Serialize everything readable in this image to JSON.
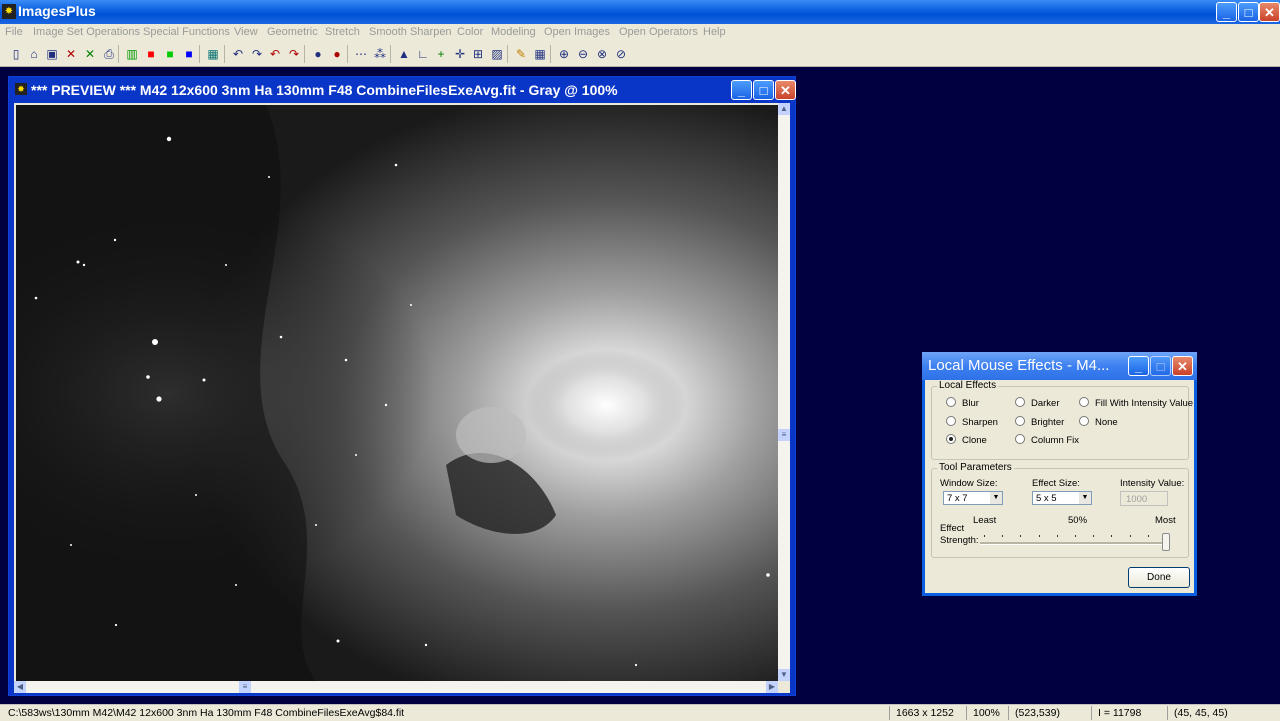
{
  "app": {
    "title": "ImagesPlus",
    "icon_glyph": "✸",
    "controls": {
      "minimize": "_",
      "maximize": "□",
      "close": "✕"
    }
  },
  "menu": [
    "File",
    "Image Set Operations",
    "Special Functions",
    "View",
    "Geometric",
    "Stretch",
    "Smooth Sharpen",
    "Color",
    "Modeling",
    "Open Images",
    "Open Operators",
    "Help"
  ],
  "toolbar_icons": [
    {
      "name": "new-file-icon",
      "glyph": "▯"
    },
    {
      "name": "open-folder-icon",
      "glyph": "⌂"
    },
    {
      "name": "save-icon",
      "glyph": "▣"
    },
    {
      "name": "close-image-icon",
      "glyph": "✕",
      "color": "#b00000"
    },
    {
      "name": "close-all-icon",
      "glyph": "✕",
      "color": "#008000"
    },
    {
      "name": "print-icon",
      "glyph": "⎙"
    },
    {
      "name": "rgb-channels-icon",
      "glyph": "▥",
      "color": "#009900"
    },
    {
      "name": "red-channel-icon",
      "glyph": "■",
      "color": "#ff0000"
    },
    {
      "name": "green-channel-icon",
      "glyph": "■",
      "color": "#00cc00"
    },
    {
      "name": "blue-channel-icon",
      "glyph": "■",
      "color": "#0000ff"
    },
    {
      "name": "grid-icon",
      "glyph": "▦",
      "color": "#007070"
    },
    {
      "name": "undo-icon",
      "glyph": "↶"
    },
    {
      "name": "redo-icon",
      "glyph": "↷"
    },
    {
      "name": "undo-all-icon",
      "glyph": "↶",
      "color": "#b00000"
    },
    {
      "name": "redo-all-icon",
      "glyph": "↷",
      "color": "#b00000"
    },
    {
      "name": "mask-icon",
      "glyph": "●"
    },
    {
      "name": "mask-red-icon",
      "glyph": "●",
      "color": "#b00000"
    },
    {
      "name": "dotted-line-icon",
      "glyph": "⋯"
    },
    {
      "name": "points-icon",
      "glyph": "⁂"
    },
    {
      "name": "histogram-icon",
      "glyph": "▲"
    },
    {
      "name": "levels-icon",
      "glyph": "∟"
    },
    {
      "name": "add-icon",
      "glyph": "+",
      "color": "#008000"
    },
    {
      "name": "crosshair-icon",
      "glyph": "✛"
    },
    {
      "name": "frame-icon",
      "glyph": "⊞"
    },
    {
      "name": "picture-icon",
      "glyph": "▨"
    },
    {
      "name": "pencil-icon",
      "glyph": "✎",
      "color": "#c08000"
    },
    {
      "name": "table-icon",
      "glyph": "▦"
    },
    {
      "name": "zoom-in-icon",
      "glyph": "⊕"
    },
    {
      "name": "zoom-out-icon",
      "glyph": "⊖"
    },
    {
      "name": "zoom-fit-icon",
      "glyph": "⊗"
    },
    {
      "name": "zoom-actual-icon",
      "glyph": "⊘"
    }
  ],
  "preview": {
    "title": "*** PREVIEW *** M42 12x600 3nm Ha 130mm F48 CombineFilesExeAvg.fit - Gray @ 100%"
  },
  "dialog": {
    "title": "Local Mouse Effects - M4...",
    "local_effects": {
      "label": "Local Effects",
      "options": [
        {
          "label": "Blur",
          "selected": false
        },
        {
          "label": "Darker",
          "selected": false
        },
        {
          "label": "Fill With Intensity Value",
          "selected": false
        },
        {
          "label": "Sharpen",
          "selected": false
        },
        {
          "label": "Brighter",
          "selected": false
        },
        {
          "label": "None",
          "selected": false
        },
        {
          "label": "Clone",
          "selected": true
        },
        {
          "label": "Column Fix",
          "selected": false
        }
      ]
    },
    "tool_parameters": {
      "label": "Tool Parameters",
      "window_size_label": "Window Size:",
      "window_size_value": "7 x 7",
      "effect_size_label": "Effect Size:",
      "effect_size_value": "5 x 5",
      "intensity_label": "Intensity Value:",
      "intensity_value": "1000",
      "effect_label": "Effect",
      "strength_label": "Strength:",
      "least": "Least",
      "mid": "50%",
      "most": "Most",
      "strength_fraction": 1.0
    },
    "done_label": "Done"
  },
  "status": {
    "path": "C:\\583ws\\130mm M42\\M42 12x600 3nm Ha 130mm F48 CombineFilesExeAvg$84.fit",
    "dimensions": "1663 x 1252",
    "zoom": "100%",
    "coords": "(523,539)",
    "intensity": "I = 11798",
    "rgb": "(45, 45, 45)"
  }
}
